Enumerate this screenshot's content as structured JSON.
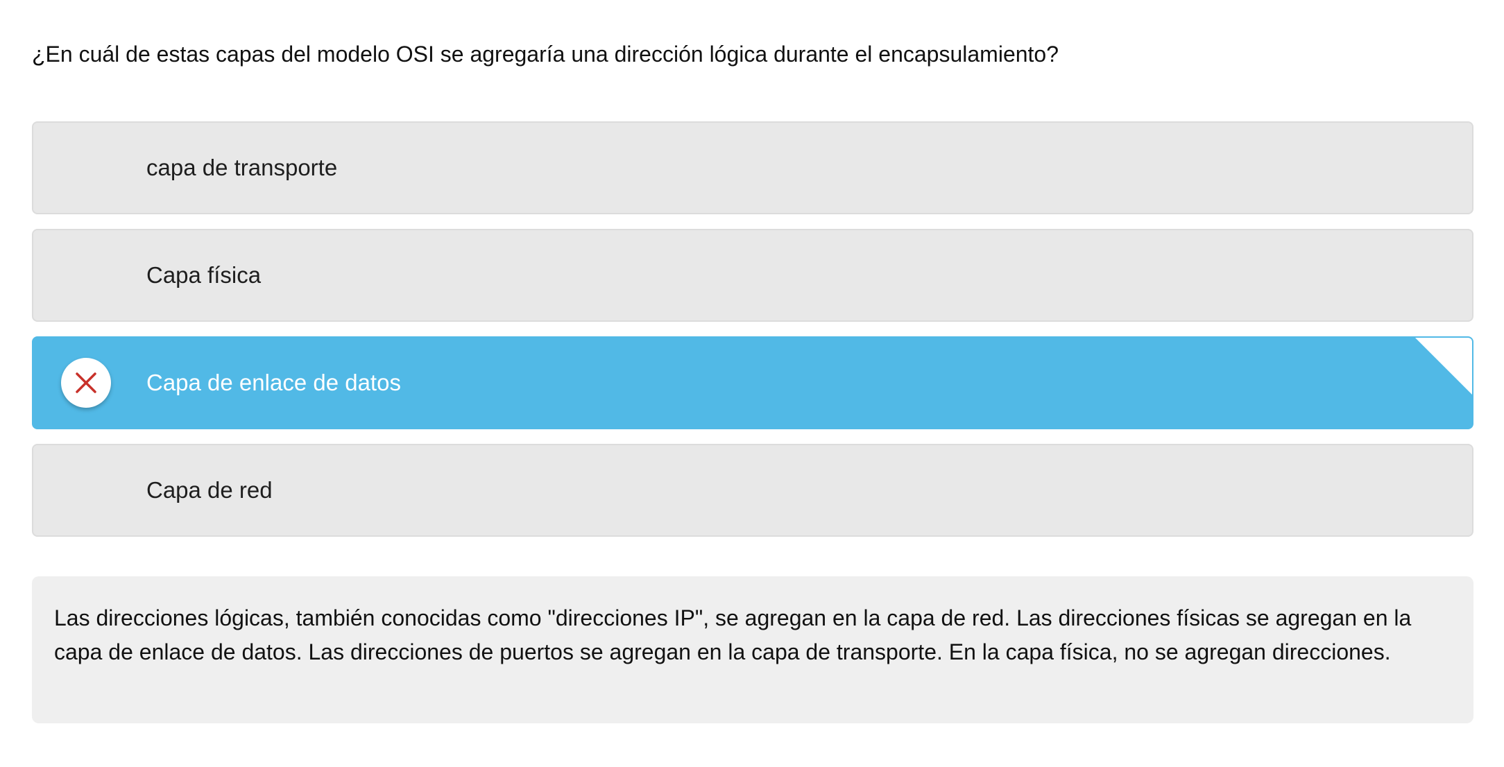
{
  "question": {
    "text": "¿En cuál de estas capas del modelo OSI se agregaría una dirección lógica durante el encapsulamiento?"
  },
  "options": [
    {
      "label": "capa de transporte",
      "state": "default"
    },
    {
      "label": "Capa física",
      "state": "default"
    },
    {
      "label": "Capa de enlace de datos",
      "state": "selected-incorrect",
      "status_icon": "close-icon"
    },
    {
      "label": "Capa de red",
      "state": "default"
    }
  ],
  "feedback": {
    "text": "Las direcciones lógicas, también conocidas como \"direcciones IP\", se agregan en la capa de red. Las direcciones físicas se agregan en la capa de enlace de datos. Las direcciones de puertos se agregan en la capa de transporte. En la capa física, no se agregan direcciones."
  },
  "colors": {
    "selected_background": "#51b9e6",
    "option_background": "#e8e8e8",
    "incorrect_mark": "#c8312a",
    "feedback_background": "#efefef"
  }
}
